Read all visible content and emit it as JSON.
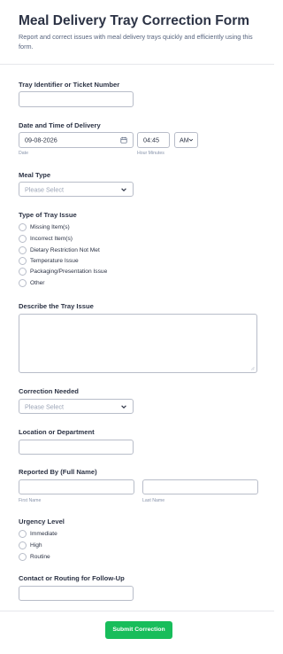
{
  "header": {
    "title": "Meal Delivery Tray Correction Form",
    "subtitle": "Report and correct issues with meal delivery trays quickly and efficiently using this form."
  },
  "tray_id": {
    "label": "Tray Identifier or Ticket Number",
    "value": ""
  },
  "delivery": {
    "label": "Date and Time of Delivery",
    "date_value": "09-08-2026",
    "date_sublabel": "Date",
    "time_value": "04:45",
    "time_sublabel": "Hour Minutes",
    "ampm_value": "AM",
    "calendar_icon": "calendar-icon"
  },
  "meal_type": {
    "label": "Meal Type",
    "placeholder": "Please Select"
  },
  "tray_issue": {
    "label": "Type of Tray Issue",
    "options": [
      "Missing Item(s)",
      "Incorrect Item(s)",
      "Dietary Restriction Not Met",
      "Temperature Issue",
      "Packaging/Presentation Issue",
      "Other"
    ]
  },
  "describe": {
    "label": "Describe the Tray Issue",
    "value": ""
  },
  "correction": {
    "label": "Correction Needed",
    "placeholder": "Please Select"
  },
  "location": {
    "label": "Location or Department",
    "value": ""
  },
  "reported_by": {
    "label": "Reported By (Full Name)",
    "first_sublabel": "First Name",
    "last_sublabel": "Last Name"
  },
  "urgency": {
    "label": "Urgency Level",
    "options": [
      "Immediate",
      "High",
      "Routine"
    ]
  },
  "contact": {
    "label": "Contact or Routing for Follow-Up",
    "value": ""
  },
  "submit": {
    "label": "Submit Correction",
    "color": "#18bd5b"
  }
}
